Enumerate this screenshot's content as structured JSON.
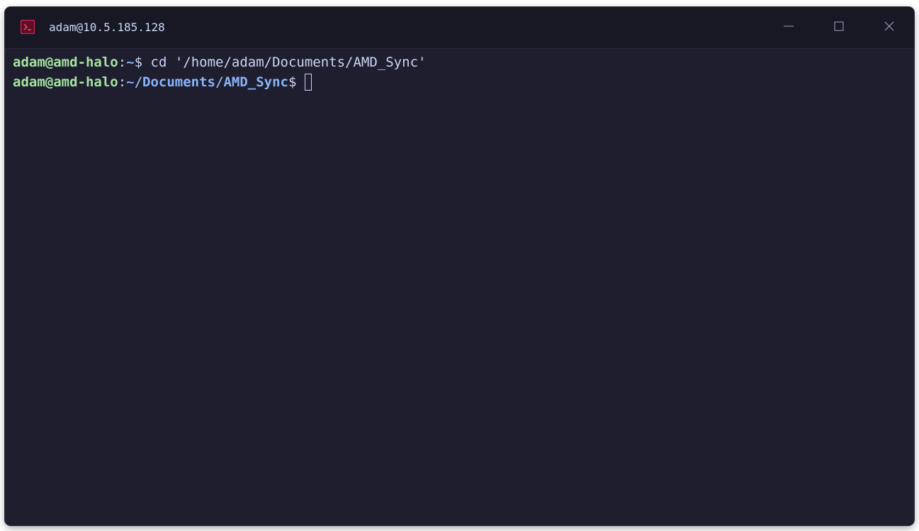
{
  "window": {
    "title": "adam@10.5.185.128",
    "icon": "terminal-icon",
    "controls": {
      "minimize": "minimize-icon",
      "maximize": "maximize-icon",
      "close": "close-icon"
    }
  },
  "terminal": {
    "lines": [
      {
        "user_host": "adam@amd-halo",
        "colon": ":",
        "path": "~",
        "prompt": "$",
        "command": " cd '/home/adam/Documents/AMD_Sync'"
      },
      {
        "user_host": "adam@amd-halo",
        "colon": ":",
        "path": "~/Documents/AMD_Sync",
        "prompt": "$",
        "command": ""
      }
    ]
  },
  "colors": {
    "background": "#1e1e2e",
    "titlebar": "#181825",
    "user_host": "#a6e3a1",
    "path": "#89b4fa",
    "text": "#cdd6f4",
    "icon_accent": "#e0245e"
  }
}
